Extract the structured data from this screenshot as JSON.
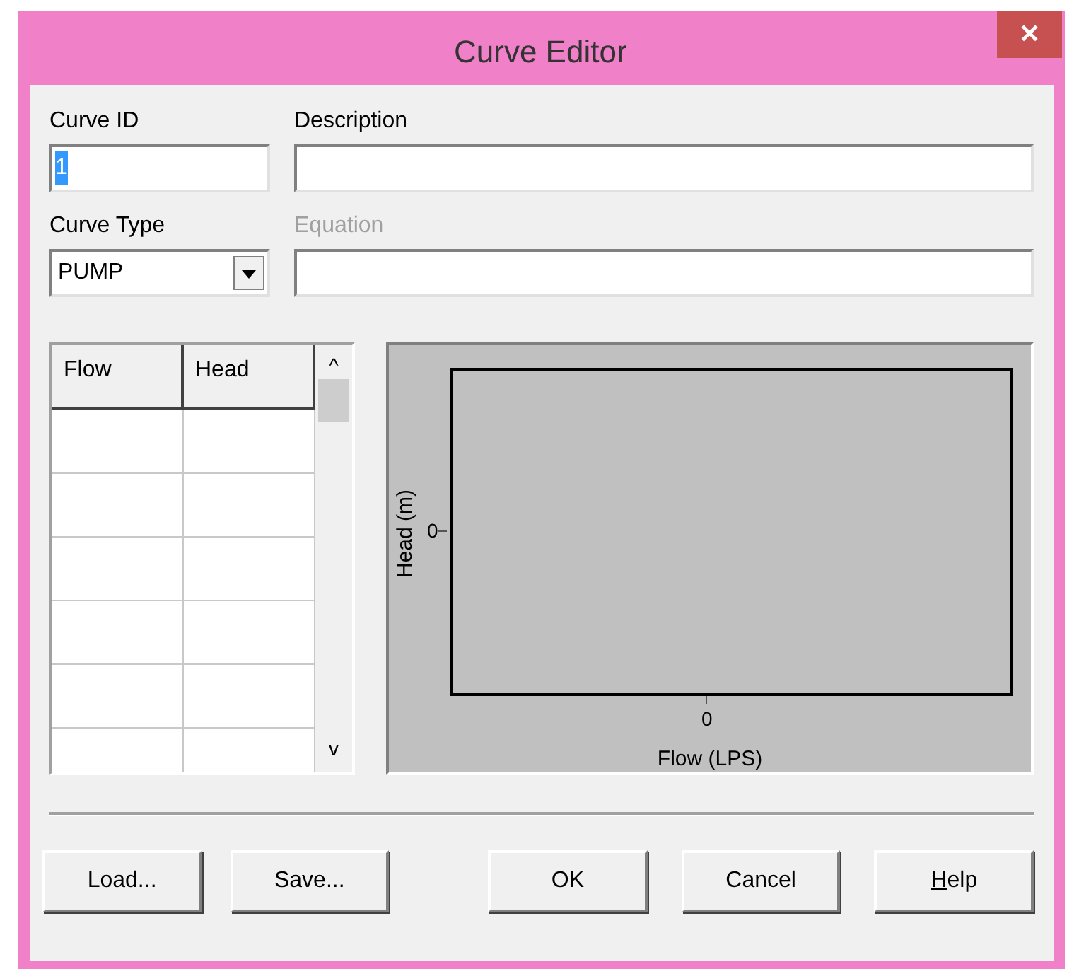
{
  "window": {
    "title": "Curve Editor",
    "close": "✕"
  },
  "curve_id": {
    "label": "Curve ID",
    "value": "1",
    "text_selected": true
  },
  "description": {
    "label": "Description"
  },
  "curve_type": {
    "label": "Curve Type",
    "value": "PUMP"
  },
  "equation": {
    "label": "Equation",
    "disabled": true
  },
  "table": {
    "columns": [
      "Flow",
      "Head"
    ],
    "scroll_up": "^",
    "scroll_down": "v"
  },
  "plot": {
    "ylabel": "Head (m)",
    "y_tick": "0",
    "x_tick": "0",
    "xlabel": "Flow (LPS)"
  },
  "left_buttons": [
    {
      "parts": [
        {
          "text": "Load...",
          "underlined": false
        }
      ]
    },
    {
      "parts": [
        {
          "text": "Save...",
          "underlined": false
        }
      ]
    }
  ],
  "right_buttons": [
    {
      "parts": [
        {
          "text": "OK",
          "underlined": false
        }
      ]
    },
    {
      "parts": [
        {
          "text": "Cancel",
          "underlined": false
        }
      ]
    },
    {
      "parts": [
        {
          "text": "H",
          "underlined": true
        },
        {
          "text": "elp",
          "underlined": false
        }
      ]
    }
  ]
}
